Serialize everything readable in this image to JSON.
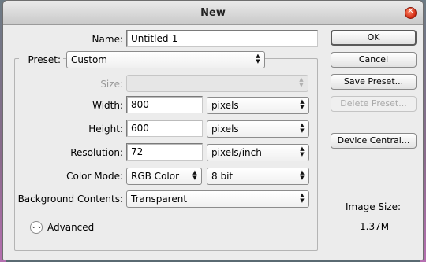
{
  "window": {
    "title": "New"
  },
  "form": {
    "name_label": "Name:",
    "name_value": "Untitled-1",
    "preset_label": "Preset:",
    "preset_value": "Custom",
    "size_label": "Size:",
    "size_value": "",
    "width_label": "Width:",
    "width_value": "800",
    "width_unit": "pixels",
    "height_label": "Height:",
    "height_value": "600",
    "height_unit": "pixels",
    "resolution_label": "Resolution:",
    "resolution_value": "72",
    "resolution_unit": "pixels/inch",
    "color_mode_label": "Color Mode:",
    "color_mode_value": "RGB Color",
    "bit_depth_value": "8 bit",
    "background_label": "Background Contents:",
    "background_value": "Transparent",
    "advanced_label": "Advanced"
  },
  "buttons": {
    "ok": "OK",
    "cancel": "Cancel",
    "save_preset": "Save Preset...",
    "delete_preset": "Delete Preset...",
    "device_central": "Device Central..."
  },
  "info": {
    "image_size_label": "Image Size:",
    "image_size_value": "1.37M"
  },
  "icons": {
    "close": "close-icon",
    "select_arrow": "updown-arrow-icon",
    "advanced": "chevron-down-icon"
  },
  "colors": {
    "dialog_bg": "#ececec",
    "close_button": "#d22a12"
  }
}
